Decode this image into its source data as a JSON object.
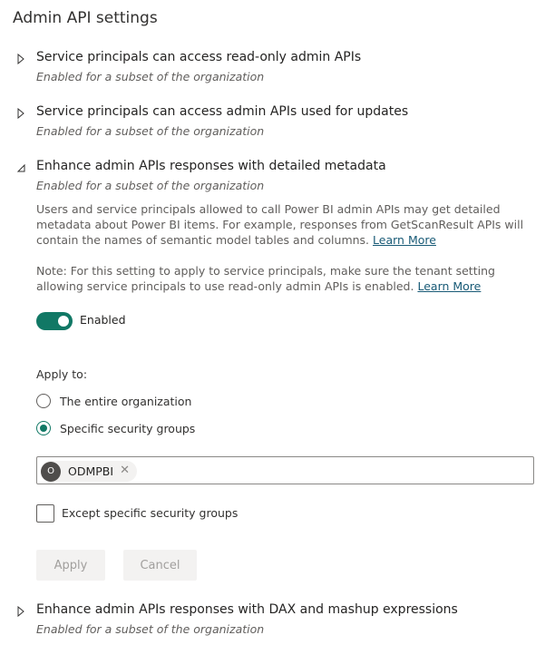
{
  "page": {
    "title": "Admin API settings"
  },
  "settings": [
    {
      "title": "Service principals can access read-only admin APIs",
      "subtitle": "Enabled for a subset of the organization",
      "expanded": false
    },
    {
      "title": "Service principals can access admin APIs used for updates",
      "subtitle": "Enabled for a subset of the organization",
      "expanded": false
    },
    {
      "title": "Enhance admin APIs responses with detailed metadata",
      "subtitle": "Enabled for a subset of the organization",
      "expanded": true
    },
    {
      "title": "Enhance admin APIs responses with DAX and mashup expressions",
      "subtitle": "Enabled for a subset of the organization",
      "expanded": false
    }
  ],
  "detail": {
    "description": "Users and service principals allowed to call Power BI admin APIs may get detailed metadata about Power BI items. For example, responses from GetScanResult APIs will contain the names of semantic model tables and columns.",
    "description_link": "Learn More",
    "note": "Note: For this setting to apply to service principals, make sure the tenant setting allowing service principals to use read-only admin APIs is enabled.",
    "note_link": "Learn More",
    "toggle": {
      "label": "Enabled",
      "on": true
    },
    "apply_to": {
      "label": "Apply to:",
      "options": [
        {
          "label": "The entire organization",
          "selected": false
        },
        {
          "label": "Specific security groups",
          "selected": true
        }
      ]
    },
    "groups": [
      {
        "initial": "O",
        "name": "ODMPBI"
      }
    ],
    "except": {
      "label": "Except specific security groups",
      "checked": false
    },
    "buttons": {
      "apply": "Apply",
      "cancel": "Cancel"
    }
  },
  "colors": {
    "accent": "#117865",
    "link": "#185a76",
    "subtitle": "#605e5c",
    "disabled_text": "#a19f9d"
  },
  "icons": {
    "collapsed": "caret-right-icon",
    "expanded": "caret-down-icon",
    "remove": "close-icon"
  }
}
